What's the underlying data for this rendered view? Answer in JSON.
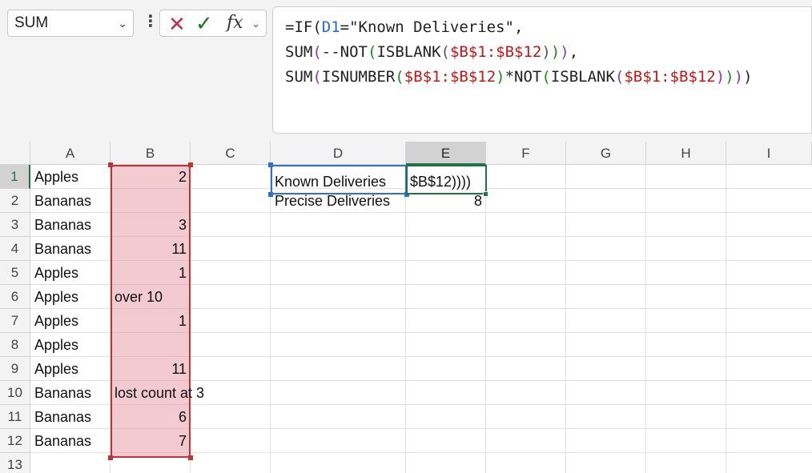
{
  "name_box": {
    "value": "SUM"
  },
  "formula_bar": {
    "line1": [
      {
        "t": "=IF(",
        "c": ""
      },
      {
        "t": "D1",
        "c": "c-blue"
      },
      {
        "t": "=\"Known Deliveries\",",
        "c": ""
      }
    ],
    "line2": [
      {
        "t": "SUM",
        "c": ""
      },
      {
        "t": "(",
        "c": "c-purple"
      },
      {
        "t": "--NOT",
        "c": ""
      },
      {
        "t": "(",
        "c": "c-green"
      },
      {
        "t": "ISBLANK",
        "c": ""
      },
      {
        "t": "(",
        "c": "c-gray"
      },
      {
        "t": "$B$1:$B$12",
        "c": "c-red"
      },
      {
        "t": ")",
        "c": "c-gray"
      },
      {
        "t": ")",
        "c": "c-green"
      },
      {
        "t": ")",
        "c": "c-purple"
      },
      {
        "t": ",",
        "c": ""
      }
    ],
    "line3": [
      {
        "t": "SUM",
        "c": ""
      },
      {
        "t": "(",
        "c": "c-purple"
      },
      {
        "t": "ISNUMBER",
        "c": ""
      },
      {
        "t": "(",
        "c": "c-green"
      },
      {
        "t": "$B$1:$B$12",
        "c": "c-red"
      },
      {
        "t": ")",
        "c": "c-green"
      },
      {
        "t": "*NOT",
        "c": ""
      },
      {
        "t": "(",
        "c": "c-green"
      },
      {
        "t": "ISBLANK",
        "c": ""
      },
      {
        "t": "(",
        "c": "c-purple"
      },
      {
        "t": "$B$1:$B$12",
        "c": "c-red"
      },
      {
        "t": ")",
        "c": "c-purple"
      },
      {
        "t": ")",
        "c": "c-green"
      },
      {
        "t": ")",
        "c": "c-purple"
      },
      {
        "t": ")",
        "c": ""
      }
    ]
  },
  "columns": [
    "A",
    "B",
    "C",
    "D",
    "E",
    "F",
    "G",
    "H",
    "I"
  ],
  "selected_column": "E",
  "rows": [
    "1",
    "2",
    "3",
    "4",
    "5",
    "6",
    "7",
    "8",
    "9",
    "10",
    "11",
    "12",
    "13"
  ],
  "selected_row": "1",
  "cells": {
    "A": [
      "Apples",
      "Bananas",
      "Bananas",
      "Bananas",
      "Apples",
      "Apples",
      "Apples",
      "Apples",
      "Apples",
      "Bananas",
      "Bananas",
      "Bananas"
    ],
    "B": [
      "2",
      "",
      "3",
      "11",
      "1",
      "over 10",
      "1",
      "",
      "11",
      "lost count at 3",
      "6",
      "7"
    ],
    "D1": "Known Deliveries",
    "D2": "Precise Deliveries",
    "E1": "$B$12))))",
    "E2": "8"
  },
  "colors": {
    "range_highlight": "#c0313a",
    "ref_highlight": "#2e6fd0",
    "active_cell": "#217346"
  }
}
